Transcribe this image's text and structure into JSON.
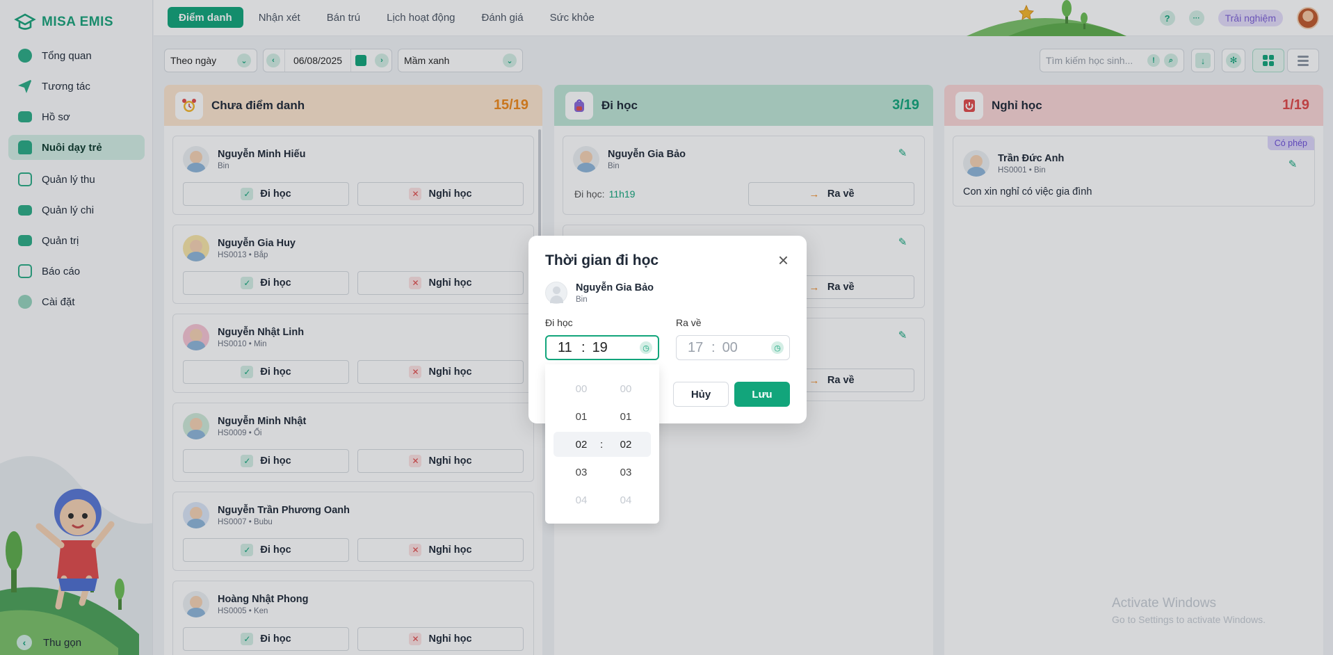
{
  "app": {
    "logo_text": "MISA EMIS"
  },
  "sidebar": {
    "items": [
      {
        "label": "Tổng quan",
        "icon": "pie-chart-icon"
      },
      {
        "label": "Tương tác",
        "icon": "send-icon"
      },
      {
        "label": "Hồ sơ",
        "icon": "folder-icon"
      },
      {
        "label": "Nuôi dạy trẻ",
        "icon": "school-icon",
        "active": true
      },
      {
        "label": "Quản lý thu",
        "icon": "income-icon"
      },
      {
        "label": "Quản lý chi",
        "icon": "wallet-icon"
      },
      {
        "label": "Quản trị",
        "icon": "briefcase-icon"
      },
      {
        "label": "Báo cáo",
        "icon": "bar-chart-icon"
      },
      {
        "label": "Cài đặt",
        "icon": "settings-icon"
      }
    ],
    "collapse_label": "Thu gọn"
  },
  "topbar": {
    "tabs": [
      "Điểm danh",
      "Nhận xét",
      "Bán trú",
      "Lịch hoạt động",
      "Đánh giá",
      "Sức khỏe"
    ],
    "active_tab": "Điểm danh",
    "help_symbol": "?",
    "more_symbol": "···",
    "trial_label": "Trải nghiệm"
  },
  "filters": {
    "period_value": "Theo ngày",
    "date_value": "06/08/2025",
    "class_value": "Mầm xanh",
    "search_placeholder": "Tìm kiếm học sinh..."
  },
  "columns": {
    "pending": {
      "title": "Chưa điểm danh",
      "count": "15/19",
      "students": [
        {
          "name": "Nguyễn Minh Hiếu",
          "sub": "Bin"
        },
        {
          "name": "Nguyễn Gia Huy",
          "sub": "HS0013 • Bắp"
        },
        {
          "name": "Nguyễn Nhật Linh",
          "sub": "HS0010 • Min"
        },
        {
          "name": "Nguyễn Minh Nhật",
          "sub": "HS0009 • Ổi"
        },
        {
          "name": "Nguyễn Trần Phương Oanh",
          "sub": "HS0007 • Bubu"
        },
        {
          "name": "Hoàng Nhật Phong",
          "sub": "HS0005 • Ken"
        }
      ],
      "present_label": "Đi học",
      "absent_label": "Nghỉ học"
    },
    "present": {
      "title": "Đi học",
      "count": "3/19",
      "students": [
        {
          "name": "Nguyễn Gia Bảo",
          "sub": "Bin",
          "time_label": "Đi học:",
          "time": "11h19"
        }
      ],
      "leave_label": "Ra về"
    },
    "absent": {
      "title": "Nghỉ học",
      "count": "1/19",
      "students": [
        {
          "name": "Trần Đức Anh",
          "sub": "HS0001 • Bin",
          "badge": "Có phép",
          "note": "Con xin nghỉ có việc gia đình"
        }
      ]
    }
  },
  "modal": {
    "title": "Thời gian đi học",
    "student_name": "Nguyễn Gia Bảo",
    "student_sub": "Bin",
    "arrive_label": "Đi học",
    "arrive_hour": "11",
    "arrive_minute": "19",
    "leave_label": "Ra về",
    "leave_hour": "17",
    "leave_minute": "00",
    "cancel_label": "Hủy",
    "save_label": "Lưu",
    "picker_rows": [
      {
        "h": "00",
        "m": "00"
      },
      {
        "h": "01",
        "m": "01"
      },
      {
        "h": "02",
        "m": "02"
      },
      {
        "h": "03",
        "m": "03"
      },
      {
        "h": "04",
        "m": "04"
      }
    ]
  },
  "watermark": {
    "line1": "Activate Windows",
    "line2": "Go to Settings to activate Windows."
  },
  "colors": {
    "accent": "#12a57b",
    "pending_header": "#fde6cf",
    "present_header": "#bfe6d6",
    "absent_header": "#fbd6d6",
    "pending_count": "#f0891b",
    "present_count": "#12a57b",
    "absent_count": "#e04848"
  }
}
